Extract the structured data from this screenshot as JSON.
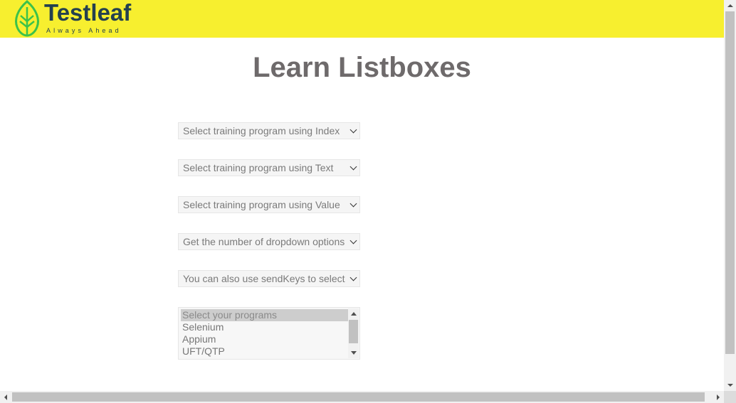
{
  "header": {
    "brand_name": "Testleaf",
    "brand_tagline": "Always Ahead",
    "brand_color": "#f7ef2f",
    "logo_icon": "leaf-icon"
  },
  "page": {
    "title": "Learn Listboxes"
  },
  "dropdowns": [
    {
      "selected": "Select training program using Index"
    },
    {
      "selected": "Select training program using Text"
    },
    {
      "selected": "Select training program using Value"
    },
    {
      "selected": "Get the number of dropdown options"
    },
    {
      "selected": "You can also use sendKeys to select"
    }
  ],
  "listbox": {
    "options": [
      "Select your programs",
      "Selenium",
      "Appium",
      "UFT/QTP"
    ],
    "selected_index": 0
  }
}
